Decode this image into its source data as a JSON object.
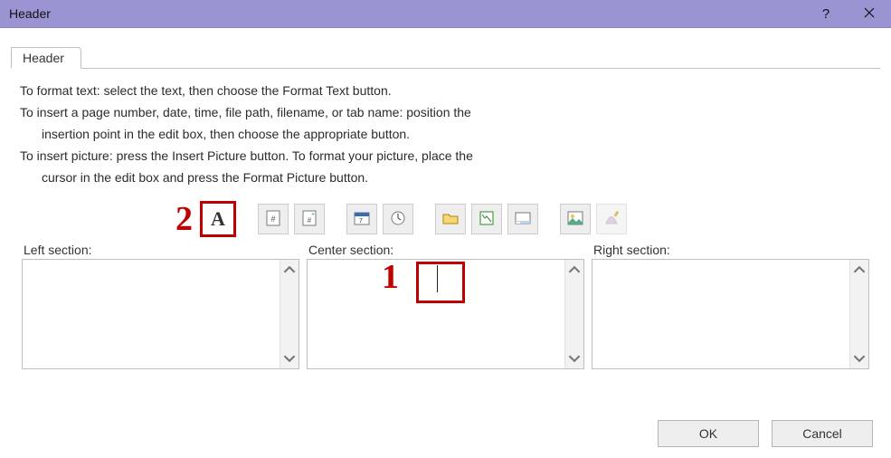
{
  "titlebar": {
    "title": "Header"
  },
  "tabs": [
    {
      "label": "Header"
    }
  ],
  "instructions": {
    "line1": "To format text:  select the text, then choose the Format Text button.",
    "line2a": "To insert a page number, date, time, file path, filename, or tab name:  position the",
    "line2b": "insertion point in the edit box, then choose the appropriate button.",
    "line3a": "To insert picture: press the Insert Picture button.  To format your picture, place the",
    "line3b": "cursor in the edit box and press the Format Picture button."
  },
  "callouts": {
    "two": "2",
    "one": "1"
  },
  "toolbar": {
    "format_text": "A",
    "icons": [
      "format-text-icon",
      "page-number-icon",
      "total-pages-icon",
      "date-icon",
      "time-icon",
      "file-path-icon",
      "file-name-icon",
      "tab-name-icon",
      "insert-picture-icon",
      "format-picture-icon"
    ]
  },
  "sections": {
    "left_label": "Left section:",
    "center_label": "Center section:",
    "right_label": "Right section:",
    "left_value": "",
    "center_value": "",
    "right_value": ""
  },
  "footer": {
    "ok": "OK",
    "cancel": "Cancel"
  }
}
